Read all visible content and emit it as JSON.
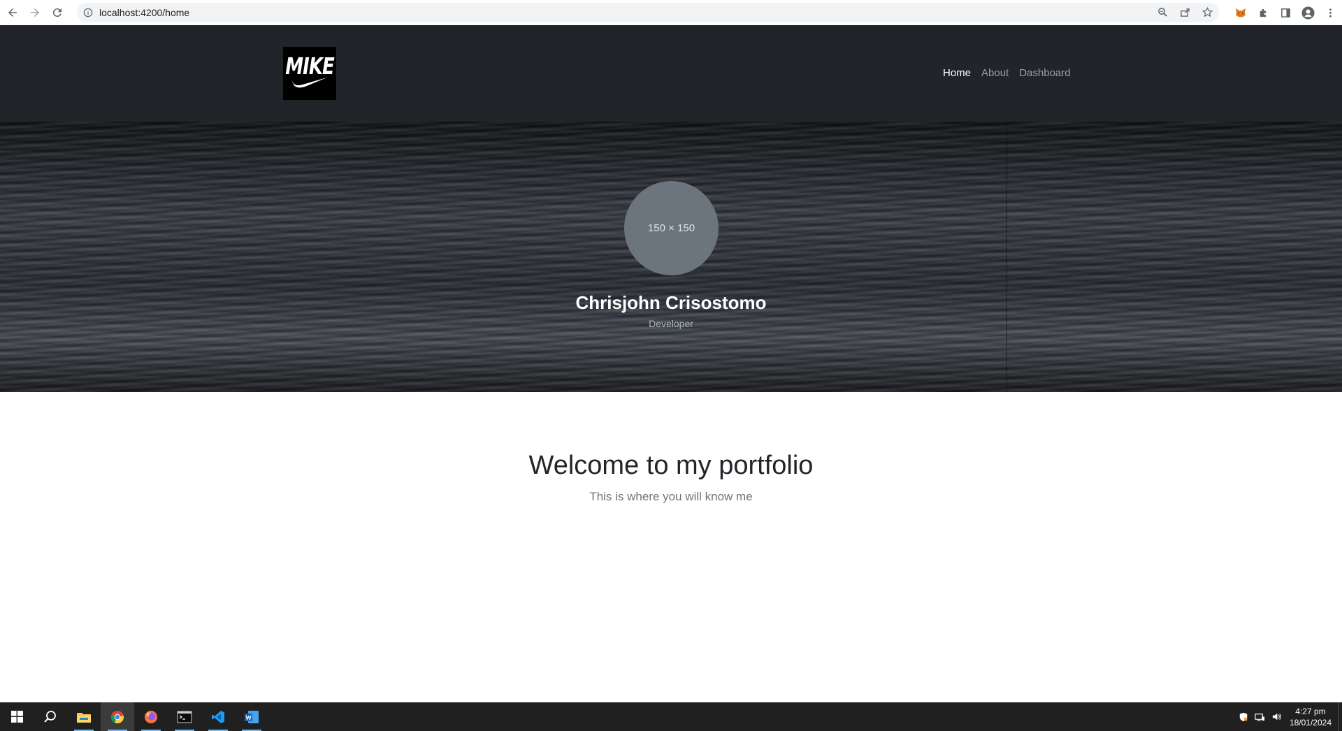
{
  "browser": {
    "url": "localhost:4200/home"
  },
  "site": {
    "logo_text": "MIKE",
    "nav": [
      {
        "label": "Home",
        "active": true
      },
      {
        "label": "About",
        "active": false
      },
      {
        "label": "Dashboard",
        "active": false
      }
    ]
  },
  "hero": {
    "avatar_placeholder": "150 × 150",
    "name": "Chrisjohn Crisostomo",
    "role": "Developer"
  },
  "welcome": {
    "title": "Welcome to my portfolio",
    "subtitle": "This is where you will know me"
  },
  "taskbar": {
    "apps": [
      "start-icon",
      "search-icon",
      "file-explorer-icon",
      "chrome-icon",
      "firefox-icon",
      "terminal-icon",
      "vscode-icon",
      "word-icon"
    ],
    "time": "4:27 pm",
    "date": "18/01/2024"
  }
}
